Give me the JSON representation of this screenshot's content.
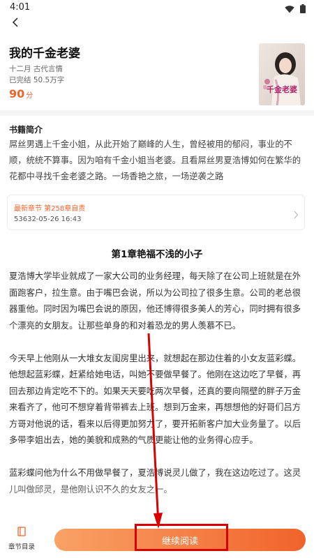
{
  "status_bar": {
    "time": "4:01"
  },
  "book": {
    "title": "我的千金老婆",
    "meta": "十二月 古代言情",
    "status": "已完结 50.5万字",
    "score": "90",
    "score_unit": "分",
    "cover_text": "千金老婆"
  },
  "synopsis": {
    "heading": "书籍简介",
    "text": "屌丝男遇上千金小姐，从此开始了巅峰的人生，曾经被用的郁闷，事业的不顺，统统不算事。因为咱有千金小姐当老婆。且看屌丝男夏浩博如何在繁华的花都中寻找千金老婆之路。一场香艳之旅，一场逆袭之路"
  },
  "latest_chapter": {
    "label": "最新章节 第258章自责",
    "date": "53632-05-26 16:43"
  },
  "chapter": {
    "title": "第1章艳福不浅的小子",
    "paragraphs": [
      "夏浩博大学毕业就成了一家大公司的业务经理，每天除了在公司上班就是在外面跑客户，拉生意。由于嘴巴会说，所以为公司拉了很多生意。公司的老总很器重他。同时因为嘴巴会说的原因，他还博得很多美人的芳心，同时拥有很多个漂亮的女朋友。让那些单身的和对着恐龙的男人羡慕不已。",
      "今天早上他刚从一大堆女友闺房里出来，就想起在那边住着的小女友蓝彩蝶。他想起蓝彩蝶，赶紧给她电话，叫她不要做早餐了。他刚在这边吃了早餐，再回去那边肯定吃不下的。如果天天要吃两次早餐，还真的要向隔壁的胖子万金来看齐了，他可不想穿着背带裤去上班。想到万金来，再想想他的好哥们吕方方哥对他说的话，看来以后得更加努力了，要开拓新客户加大业务量了。以后多带李姐出去，她的美貌和成熟的气质更能让他的业务得心应手。",
      "蓝彩蝶问他为什么不用做早餐了，夏浩博说灵儿做了，我在这边吃过了。这灵儿叫做邱灵，是他刚认识不久的女友之一。"
    ]
  },
  "bottom_bar": {
    "toc_label": "章节目录",
    "continue_label": "继续阅读"
  },
  "colors": {
    "accent": "#f0632b",
    "annotation": "#d90000"
  },
  "icons": [
    "wifi-icon",
    "battery-icon",
    "back-arrow-icon",
    "chevron-right-icon",
    "book-toc-icon"
  ]
}
